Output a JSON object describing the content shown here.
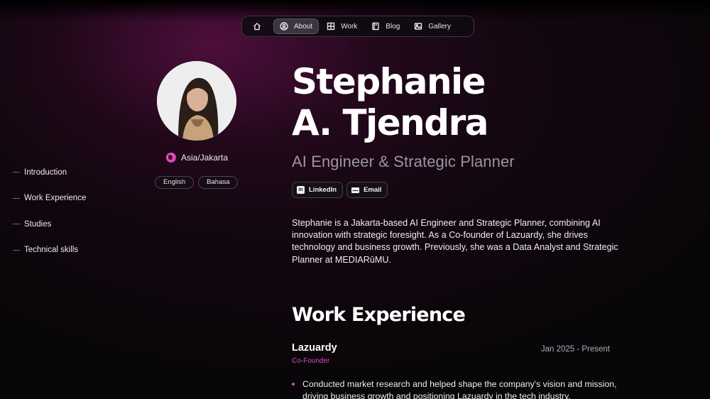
{
  "nav": {
    "items": [
      {
        "label": "About",
        "icon": "user-circle-icon"
      },
      {
        "label": "Work",
        "icon": "grid-icon"
      },
      {
        "label": "Blog",
        "icon": "book-icon"
      },
      {
        "label": "Gallery",
        "icon": "image-icon"
      }
    ],
    "active": "About"
  },
  "toc": {
    "items": [
      "Introduction",
      "Work Experience",
      "Studies",
      "Technical skills"
    ]
  },
  "profile": {
    "location": "Asia/Jakarta",
    "languages": [
      "English",
      "Bahasa"
    ]
  },
  "hero": {
    "name_line1": "Stephanie",
    "name_line2": "A. Tjendra",
    "role": "AI Engineer & Strategic Planner",
    "links": [
      "LinkedIn",
      "Email"
    ],
    "bio": "Stephanie is a Jakarta-based AI Engineer and Strategic Planner, combining AI innovation with strategic foresight. As a Co-founder of Lazuardy, she drives technology and business growth. Previously, she was a Data Analyst and Strategic Planner at MEDIARūMU."
  },
  "work": {
    "title": "Work Experience",
    "jobs": [
      {
        "company": "Lazuardy",
        "date": "Jan 2025 - Present",
        "role": "Co-Founder",
        "bullets": [
          "Conducted market research and helped shape the company's vision and mission, driving business growth and positioning Lazuardy in the tech industry."
        ]
      }
    ]
  },
  "colors": {
    "accent": "#e04ac0",
    "background": "#080608",
    "muted_text": "#9a96a0"
  }
}
